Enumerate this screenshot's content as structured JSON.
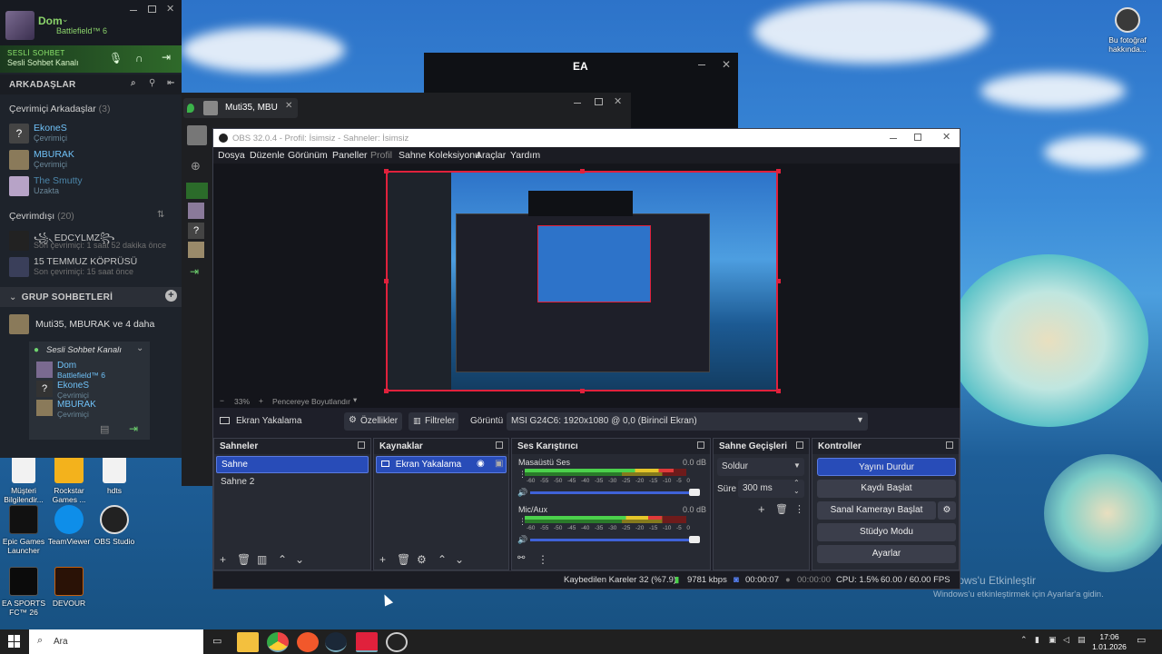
{
  "steam": {
    "user_name": "Dom",
    "user_game": "Battlefield™ 6",
    "voice_label": "SESLİ SOHBET",
    "voice_channel": "Sesli Sohbet Kanalı",
    "friends_title": "ARKADAŞLAR",
    "online_heading": "Çevrimiçi Arkadaşlar",
    "online_count": "(3)",
    "online": [
      {
        "name": "EkoneS",
        "status": "Çevrimiçi"
      },
      {
        "name": "MBURAK",
        "status": "Çevrimiçi"
      },
      {
        "name": "The Smutty",
        "status": "Uzakta"
      }
    ],
    "offline_heading": "Çevrimdışı",
    "offline_count": "(20)",
    "offline": [
      {
        "name": "꧁৲EDCYLMZ꧂",
        "status": "Son çevrimiçi: 1 saat 52 dakika önce"
      },
      {
        "name": "15 TEMMUZ KÖPRÜSÜ",
        "status": "Son çevrimiçi: 15 saat önce"
      }
    ],
    "group_title": "GRUP SOHBETLERİ",
    "group_name": "Muti35, MBURAK ve 4 daha",
    "group_voice": "Sesli Sohbet Kanalı",
    "group_members": [
      {
        "name": "Dom",
        "status": "Battlefield™ 6"
      },
      {
        "name": "EkoneS",
        "status": "Çevrimiçi"
      },
      {
        "name": "MBURAK",
        "status": "Çevrimiçi"
      }
    ]
  },
  "ea_window": {
    "title": "EA"
  },
  "chat_window": {
    "tab": "Muti35, MBU"
  },
  "obs": {
    "title": "OBS 32.0.4 - Profil: İsimsiz - Sahneler: İsimsiz",
    "menu": [
      "Dosya",
      "Düzenle",
      "Görünüm",
      "Paneller",
      "Profil",
      "Sahne Koleksiyonu",
      "Araçlar",
      "Yardım"
    ],
    "zoom": "33%",
    "resize_label": "Pencereye Boyutlandır",
    "source_name": "Ekran Yakalama",
    "props_btn": "Özellikler",
    "filters_btn": "Filtreler",
    "display_label": "Görüntü",
    "display_value": "MSI G24C6: 1920x1080 @ 0,0 (Birincil Ekran)",
    "scenes_title": "Sahneler",
    "scenes": [
      "Sahne",
      "Sahne 2"
    ],
    "sources_title": "Kaynaklar",
    "sources": [
      "Ekran Yakalama"
    ],
    "mixer_title": "Ses Karıştırıcı",
    "mixer": [
      {
        "name": "Masaüstü Ses",
        "db": "0.0 dB"
      },
      {
        "name": "Mic/Aux",
        "db": "0.0 dB"
      }
    ],
    "meter_ticks": [
      "-60",
      "-55",
      "-50",
      "-45",
      "-40",
      "-35",
      "-30",
      "-25",
      "-20",
      "-15",
      "-10",
      "-5",
      "0"
    ],
    "transitions_title": "Sahne Geçişleri",
    "transition": "Soldur",
    "duration_label": "Süre",
    "duration": "300 ms",
    "controls_title": "Kontroller",
    "controls": [
      "Yayını Durdur",
      "Kaydı Başlat",
      "Sanal Kamerayı Başlat",
      "Stüdyo Modu",
      "Ayarlar"
    ],
    "status": {
      "dropped": "Kaybedilen Kareler 32 (%7.9)",
      "bitrate": "9781 kbps",
      "stream_time": "00:00:07",
      "rec_time": "00:00:00",
      "cpu": "CPU: 1.5%",
      "fps": "60.00 / 60.00 FPS"
    }
  },
  "desktop": {
    "top_right_icon": "Bu fotoğraf hakkında...",
    "icons": [
      {
        "label": "Müşteri Bilgilendir..."
      },
      {
        "label": "Rockstar Games ..."
      },
      {
        "label": "hdts"
      },
      {
        "label": "Epic Games Launcher"
      },
      {
        "label": "TeamViewer"
      },
      {
        "label": "OBS Studio"
      },
      {
        "label": "EA SPORTS FC™ 26"
      },
      {
        "label": "DEVOUR"
      }
    ],
    "watermark_title": "Windows'u Etkinleştir",
    "watermark_sub": "Windows'u etkinleştirmek için Ayarlar'a gidin."
  },
  "taskbar": {
    "search": "Ara",
    "time": "17:06",
    "date": "1.01.2026"
  }
}
